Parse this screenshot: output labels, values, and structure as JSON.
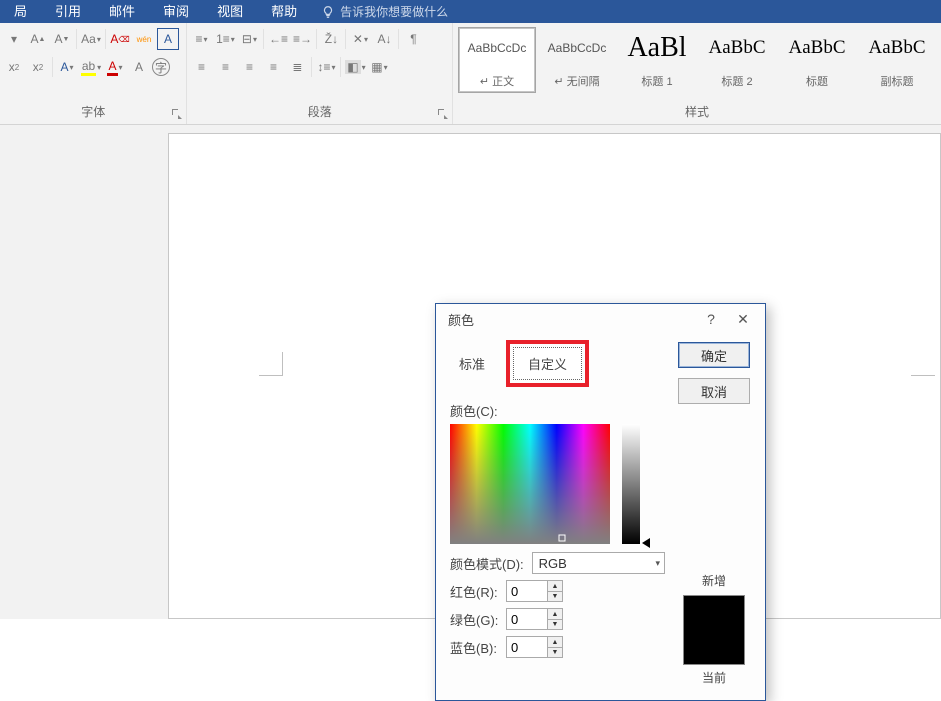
{
  "menu": {
    "items": [
      "局",
      "引用",
      "邮件",
      "审阅",
      "视图",
      "帮助"
    ],
    "tell_me": "告诉我你想要做什么"
  },
  "ribbon": {
    "font_group": "字体",
    "para_group": "段落",
    "styles_group": "样式",
    "styles": [
      {
        "preview": "AaBbCcDc",
        "label": "↵ 正文"
      },
      {
        "preview": "AaBbCcDc",
        "label": "↵ 无间隔"
      },
      {
        "preview": "AaBl",
        "label": "标题 1"
      },
      {
        "preview": "AaBbC",
        "label": "标题 2"
      },
      {
        "preview": "AaBbC",
        "label": "标题"
      },
      {
        "preview": "AaBbC",
        "label": "副标题"
      }
    ]
  },
  "dialog": {
    "title": "颜色",
    "help": "?",
    "close": "✕",
    "tab_standard": "标准",
    "tab_custom": "自定义",
    "ok": "确定",
    "cancel": "取消",
    "color_c": "颜色(C):",
    "mode_d": "颜色模式(D):",
    "mode_value": "RGB",
    "red": "红色(R):",
    "green": "绿色(G):",
    "blue": "蓝色(B):",
    "r": "0",
    "g": "0",
    "b": "0",
    "new": "新增",
    "current": "当前"
  }
}
